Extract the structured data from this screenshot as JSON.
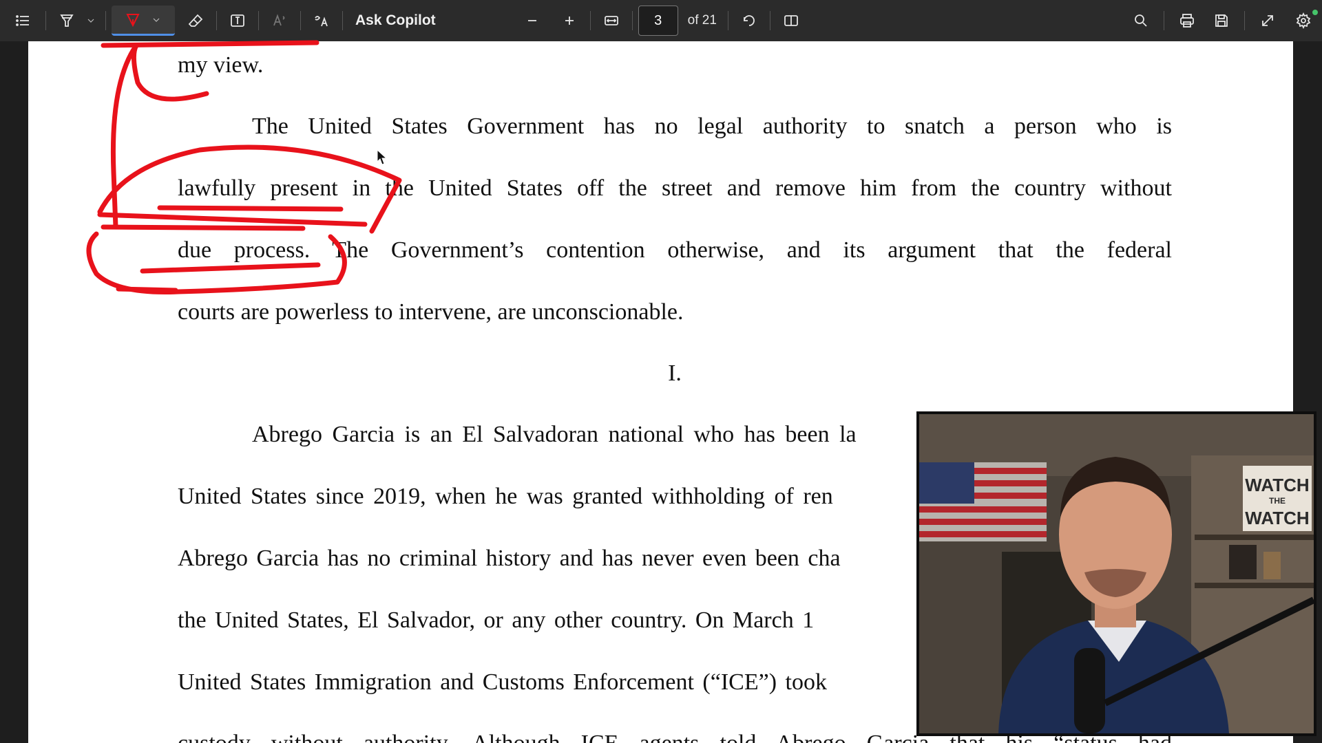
{
  "toolbar": {
    "ask_copilot": "Ask Copilot",
    "current_page": "3",
    "page_total": "of 21"
  },
  "document": {
    "lines": [
      "my view.",
      "The United States Government has no legal authority to snatch a person who is",
      "lawfully present in the United States off the street and remove him from the country without",
      "due process.  The Government’s contention otherwise, and its argument that the federal",
      "courts are powerless to intervene, are unconscionable.",
      "I.",
      "Abrego Garcia is an El Salvadoran national who has been la",
      "United States since 2019, when he was granted withholding of ren",
      "Abrego Garcia has no criminal history and has never even been cha",
      "the United States, El Salvador, or any other country.  On March 1",
      "United States Immigration and Customs Enforcement (“ICE”) took",
      "custody without authority.  Although ICE agents told Abrego Garcia that his “status had"
    ]
  },
  "webcam": {
    "sign_text_1": "WATCH",
    "sign_text_2": "THE",
    "sign_text_3": "WATCH"
  },
  "colors": {
    "toolbar_bg": "#2b2b2b",
    "ink_red": "#e8121b",
    "accent_blue": "#4f8fe8",
    "page_bg": "#ffffff"
  },
  "icons": [
    "list-icon",
    "highlighter-icon",
    "pen-icon",
    "eraser-icon",
    "text-box-icon",
    "read-aloud-icon",
    "translate-icon",
    "zoom-out-icon",
    "zoom-in-icon",
    "fit-width-icon",
    "rotate-icon",
    "page-view-icon",
    "search-icon",
    "print-icon",
    "save-icon",
    "fullscreen-icon",
    "settings-icon"
  ]
}
